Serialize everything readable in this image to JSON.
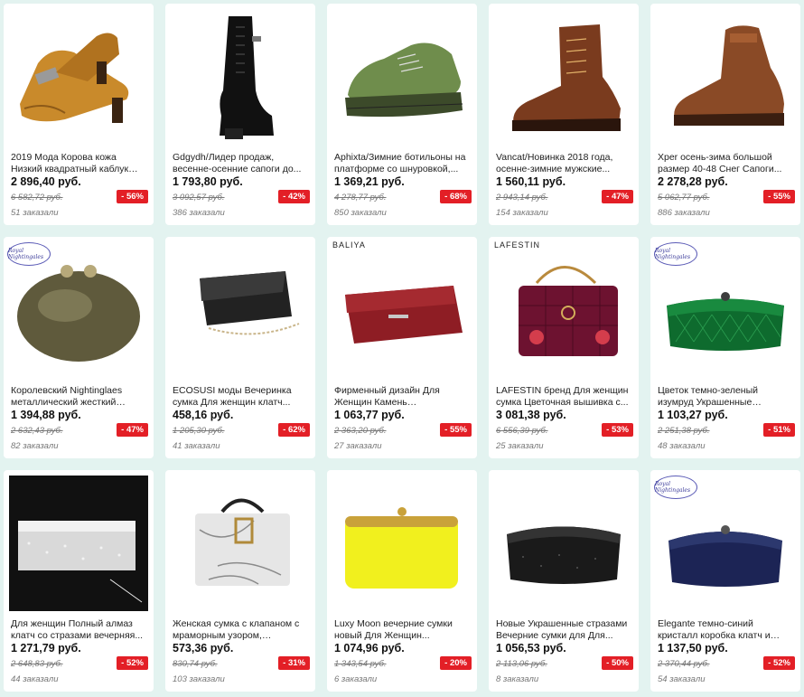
{
  "products": [
    {
      "title": "2019 Мода Корова кожа Низкий квадратный каблук Большие...",
      "price": "2 896,40 руб.",
      "old_price": "6 582,72 руб.",
      "discount": "- 56%",
      "orders": "51 заказали",
      "image": "shoe-heel-icon"
    },
    {
      "title": "Gdgydh/Лидер продаж, весенне-осенние сапоги до...",
      "price": "1 793,80 руб.",
      "old_price": "3 092,57 руб.",
      "discount": "- 42%",
      "orders": "386 заказали",
      "image": "boot-tall-icon"
    },
    {
      "title": "Aphixta/Зимние ботильоны на платформе со шнуровкой,...",
      "price": "1 369,21 руб.",
      "old_price": "4 278,77 руб.",
      "discount": "- 68%",
      "orders": "850 заказали",
      "image": "sneaker-platform-icon"
    },
    {
      "title": "Vancat/Новинка 2018 года, осенне-зимние мужские...",
      "price": "1 560,11 руб.",
      "old_price": "2 943,14 руб.",
      "discount": "- 47%",
      "orders": "154 заказали",
      "image": "boot-brown-icon"
    },
    {
      "title": "Xper осень-зима большой размер 40-48 Снег Сапоги...",
      "price": "2 278,28 руб.",
      "old_price": "5 062,77 руб.",
      "discount": "- 55%",
      "orders": "886 заказали",
      "image": "boot-men-icon"
    },
    {
      "title": "Королевский Nightinglaes металлический жесткий чехо...",
      "price": "1 394,88 руб.",
      "old_price": "2 632,43 руб.",
      "discount": "- 47%",
      "orders": "82 заказали",
      "image": "clutch-shell-icon",
      "badge": "Royal Nightingales"
    },
    {
      "title": "ECOSUSI моды Вечеринка сумка Для женщин клатч...",
      "price": "458,16 руб.",
      "old_price": "1 205,30 руб.",
      "discount": "- 62%",
      "orders": "41 заказали",
      "image": "clutch-glitter-icon"
    },
    {
      "title": "Фирменный дизайн Для Женщин Камень натуральная...",
      "price": "1 063,77 руб.",
      "old_price": "2 363,20 руб.",
      "discount": "- 55%",
      "orders": "27 заказали",
      "image": "wallet-red-icon",
      "brand": "BALIYA"
    },
    {
      "title": "LAFESTIN бренд Для женщин сумка Цветочная вышивка с...",
      "price": "3 081,38 руб.",
      "old_price": "6 556,39 руб.",
      "discount": "- 53%",
      "orders": "25 заказали",
      "image": "bag-velvet-icon",
      "brand": "LAFESTIN"
    },
    {
      "title": "Цветок темно-зеленый изумруд Украшенные стразами клатч...",
      "price": "1 103,27 руб.",
      "old_price": "2 251,38 руб.",
      "discount": "- 51%",
      "orders": "48 заказали",
      "image": "clutch-green-icon",
      "badge": "Royal Nightingales"
    },
    {
      "title": "Для женщин Полный алмаз клатч со стразами вечерняя...",
      "price": "1 271,79 руб.",
      "old_price": "2 648,83 руб.",
      "discount": "- 52%",
      "orders": "44 заказали",
      "image": "clutch-diamond-icon"
    },
    {
      "title": "Женская сумка с клапаном с мраморным узором, кожаная...",
      "price": "573,36 руб.",
      "old_price": "830,74 руб.",
      "discount": "- 31%",
      "orders": "103 заказали",
      "image": "bag-marble-icon"
    },
    {
      "title": "Luxy Moon вечерние сумки новый Для Женщин...",
      "price": "1 074,96 руб.",
      "old_price": "1 343,54 руб.",
      "discount": "- 20%",
      "orders": "6 заказали",
      "image": "clutch-yellow-icon"
    },
    {
      "title": "Новые Украшенные стразами Вечерние сумки для Для...",
      "price": "1 056,53 руб.",
      "old_price": "2 113,06 руб.",
      "discount": "- 50%",
      "orders": "8 заказали",
      "image": "clutch-black-icon"
    },
    {
      "title": "Elegante темно-синий кристалл коробка клатч и кошельки со...",
      "price": "1 137,50 руб.",
      "old_price": "2 370,44 руб.",
      "discount": "- 52%",
      "orders": "54 заказали",
      "image": "clutch-navy-icon",
      "badge": "Royal Nightingales"
    }
  ]
}
